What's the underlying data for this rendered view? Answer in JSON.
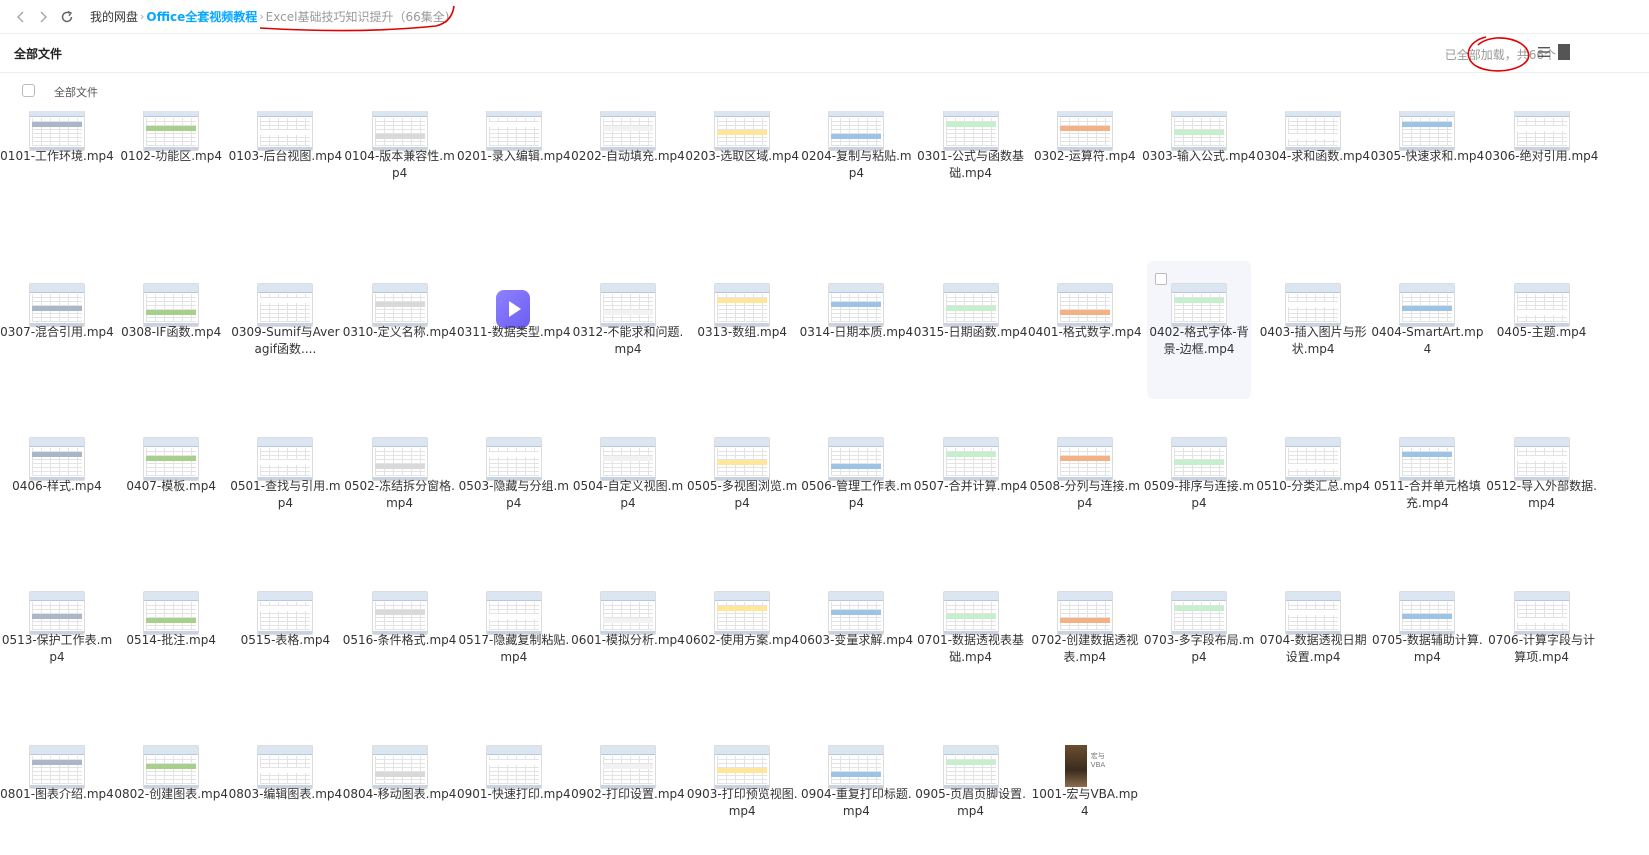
{
  "breadcrumb": {
    "home": "我的网盘",
    "folder": "Office全套视频教程",
    "current": "Excel基础技巧知识提升（66集全)"
  },
  "header": {
    "title": "全部文件",
    "count_text": "已全部加载，共66个"
  },
  "select_all_label": "全部文件",
  "colors": {
    "accent": "#06a7ff",
    "annotation": "#e00000"
  },
  "files": [
    "0101-工作环境.mp4",
    "0102-功能区.mp4",
    "0103-后台视图.mp4",
    "0104-版本兼容性.mp4",
    "0201-录入编辑.mp4",
    "0202-自动填充.mp4",
    "0203-选取区域.mp4",
    "0204-复制与粘贴.mp4",
    "0301-公式与函数基础.mp4",
    "0302-运算符.mp4",
    "0303-输入公式.mp4",
    "0304-求和函数.mp4",
    "0305-快速求和.mp4",
    "0306-绝对引用.mp4",
    "0307-混合引用.mp4",
    "0308-IF函数.mp4",
    "0309-Sumif与Averagif函数.mp4",
    "0310-定义名称.mp4",
    "0311-数据类型.mp4",
    "0312-不能求和问题.mp4",
    "0313-数组.mp4",
    "0314-日期本质.mp4",
    "0315-日期函数.mp4",
    "0401-格式数字.mp4",
    "0402-格式字体-背景-边框.mp4",
    "0403-插入图片与形状.mp4",
    "0404-SmartArt.mp4",
    "0405-主题.mp4",
    "0406-样式.mp4",
    "0407-模板.mp4",
    "0501-查找与引用.mp4",
    "0502-冻结拆分窗格.mp4",
    "0503-隐藏与分组.mp4",
    "0504-自定义视图.mp4",
    "0505-多视图浏览.mp4",
    "0506-管理工作表.mp4",
    "0507-合并计算.mp4",
    "0508-分列与连接.mp4",
    "0509-排序与连接.mp4",
    "0510-分类汇总.mp4",
    "0511-合并单元格填充.mp4",
    "0512-导入外部数据.mp4",
    "0513-保护工作表.mp4",
    "0514-批注.mp4",
    "0515-表格.mp4",
    "0516-条件格式.mp4",
    "0517-隐藏复制粘贴.mp4",
    "0601-模拟分析.mp4",
    "0602-使用方案.mp4",
    "0603-变量求解.mp4",
    "0701-数据透视表基础.mp4",
    "0702-创建数据透视表.mp4",
    "0703-多字段布局.mp4",
    "0704-数据透视日期设置.mp4",
    "0705-数据辅助计算.mp4",
    "0706-计算字段与计算项.mp4",
    "0801-图表介绍.mp4",
    "0802-创建图表.mp4",
    "0803-编辑图表.mp4",
    "0804-移动图表.mp4",
    "0901-快速打印.mp4",
    "0902-打印设置.mp4",
    "0903-打印预览视图.mp4",
    "0904-重复打印标题.mp4",
    "0905-页眉页脚设置.mp4",
    "1001-宏与VBA.mp4"
  ],
  "display_names": [
    "0101-工作环境.mp4",
    "0102-功能区.mp4",
    "0103-后台视图.mp4",
    "0104-版本兼容性.mp4",
    "0201-录入编辑.mp4",
    "0202-自动填充.mp4",
    "0203-选取区域.mp4",
    "0204-复制与粘贴.mp4",
    "0301-公式与函数基础.mp4",
    "0302-运算符.mp4",
    "0303-输入公式.mp4",
    "0304-求和函数.mp4",
    "0305-快速求和.mp4",
    "0306-绝对引用.mp4",
    "0307-混合引用.mp4",
    "0308-IF函数.mp4",
    "0309-Sumif与Averagif函数....",
    "0310-定义名称.mp4",
    "0311-数据类型.mp4",
    "0312-不能求和问题.mp4",
    "0313-数组.mp4",
    "0314-日期本质.mp4",
    "0315-日期函数.mp4",
    "0401-格式数字.mp4",
    "0402-格式字体-背景-边框.mp4",
    "0403-插入图片与形状.mp4",
    "0404-SmartArt.mp4",
    "0405-主题.mp4",
    "0406-样式.mp4",
    "0407-模板.mp4",
    "0501-查找与引用.mp4",
    "0502-冻结拆分窗格.mp4",
    "0503-隐藏与分组.mp4",
    "0504-自定义视图.mp4",
    "0505-多视图浏览.mp4",
    "0506-管理工作表.mp4",
    "0507-合并计算.mp4",
    "0508-分列与连接.mp4",
    "0509-排序与连接.mp4",
    "0510-分类汇总.mp4",
    "0511-合并单元格填充.mp4",
    "0512-导入外部数据.mp4",
    "0513-保护工作表.mp4",
    "0514-批注.mp4",
    "0515-表格.mp4",
    "0516-条件格式.mp4",
    "0517-隐藏复制粘贴.mp4",
    "0601-模拟分析.mp4",
    "0602-使用方案.mp4",
    "0603-变量求解.mp4",
    "0701-数据透视表基础.mp4",
    "0702-创建数据透视表.mp4",
    "0703-多字段布局.mp4",
    "0704-数据透视日期设置.mp4",
    "0705-数据辅助计算.mp4",
    "0706-计算字段与计算项.mp4",
    "0801-图表介绍.mp4",
    "0802-创建图表.mp4",
    "0803-编辑图表.mp4",
    "0804-移动图表.mp4",
    "0901-快速打印.mp4",
    "0902-打印设置.mp4",
    "0903-打印预览视图.mp4",
    "0904-重复打印标题.mp4",
    "0905-页眉页脚设置.mp4",
    "1001-宏与VBA.mp4"
  ],
  "photo_thumb_text": "宏与VBA"
}
